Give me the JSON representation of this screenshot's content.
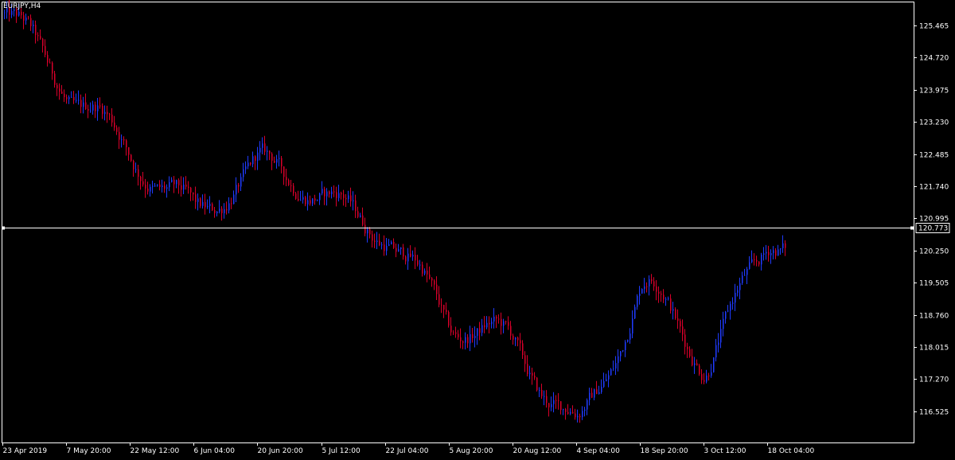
{
  "symbol_label": "EURJPY,H4",
  "colors": {
    "background": "#000000",
    "frame": "#ffffff",
    "text": "#ffffff",
    "bull": "#1f3bff",
    "bear": "#d8002a",
    "price_line": "#ffffff",
    "price_box_bg": "#000000",
    "price_box_text": "#ffffff"
  },
  "chart_data": {
    "type": "candlestick",
    "title": "EURJPY,H4",
    "ylim": [
      115.8,
      126.02
    ],
    "y_ticks": [
      "125.465",
      "124.720",
      "123.975",
      "123.230",
      "122.485",
      "121.740",
      "120.995",
      "120.250",
      "119.505",
      "118.760",
      "118.015",
      "117.270",
      "116.525"
    ],
    "x_ticks": [
      "23 Apr 2019",
      "7 May 20:00",
      "22 May 12:00",
      "6 Jun 04:00",
      "20 Jun 20:00",
      "5 Jul 12:00",
      "22 Jul 04:00",
      "5 Aug 20:00",
      "20 Aug 12:00",
      "4 Sep 04:00",
      "18 Sep 20:00",
      "3 Oct 12:00",
      "18 Oct 04:00"
    ],
    "current_price": "120.773",
    "grid": false,
    "series": [
      {
        "x": [
          "23 Apr 2019",
          "7 May 20:00",
          "22 May 12:00",
          "6 Jun 04:00",
          "20 Jun 20:00",
          "5 Jul 12:00",
          "22 Jul 04:00",
          "5 Aug 20:00",
          "20 Aug 12:00",
          "4 Sep 04:00",
          "18 Sep 20:00",
          "3 Oct 12:00",
          "18 Oct 04:00"
        ],
        "anchor_prices": [
          125.75,
          123.7,
          122.6,
          121.25,
          122.0,
          121.5,
          120.9,
          118.4,
          117.9,
          116.3,
          119.5,
          117.3,
          120.8
        ]
      }
    ]
  }
}
